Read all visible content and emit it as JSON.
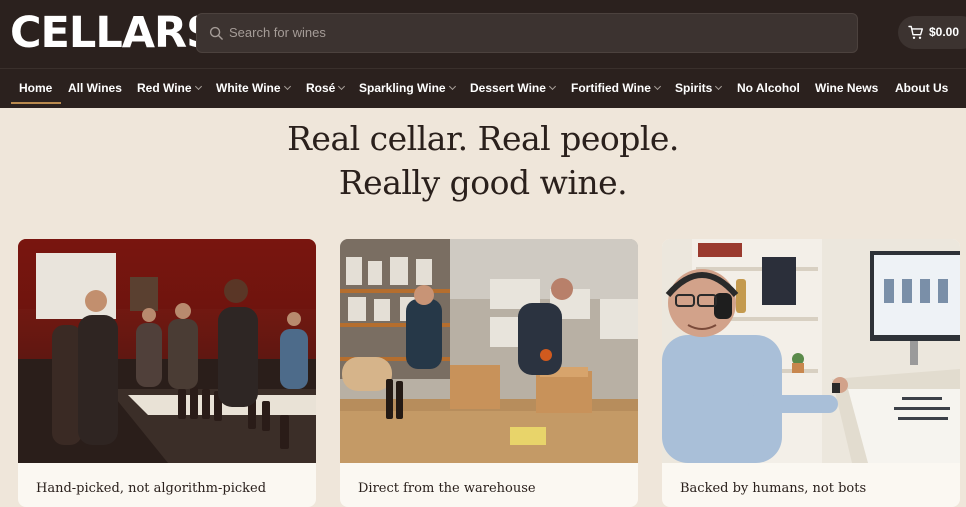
{
  "brand": {
    "logo_text": "CELLARS"
  },
  "search": {
    "placeholder": "Search for wines"
  },
  "cart": {
    "total": "$0.00",
    "icon": "cart-icon"
  },
  "nav": {
    "items": [
      {
        "label": "Home",
        "active": true,
        "dropdown": false
      },
      {
        "label": "All Wines",
        "dropdown": false
      },
      {
        "label": "Red Wine",
        "dropdown": true
      },
      {
        "label": "White Wine",
        "dropdown": true
      },
      {
        "label": "Rosé",
        "dropdown": true
      },
      {
        "label": "Sparkling Wine",
        "dropdown": true
      },
      {
        "label": "Dessert Wine",
        "dropdown": true
      },
      {
        "label": "Fortified Wine",
        "dropdown": true
      },
      {
        "label": "Spirits",
        "dropdown": true
      },
      {
        "label": "No Alcohol",
        "dropdown": false
      },
      {
        "label": "Wine News",
        "dropdown": false
      },
      {
        "label": "About Us",
        "dropdown": false
      }
    ]
  },
  "hero": {
    "line1": "Real cellar. Real people.",
    "line2": "Really good wine."
  },
  "cards": [
    {
      "caption": "Hand-picked, not algorithm-picked"
    },
    {
      "caption": "Direct from the warehouse"
    },
    {
      "caption": "Backed by humans, not bots"
    }
  ],
  "colors": {
    "header_bg": "#2b211e",
    "page_bg": "#efe6da",
    "accent": "#b98a4e",
    "text_dark": "#2a201c"
  }
}
